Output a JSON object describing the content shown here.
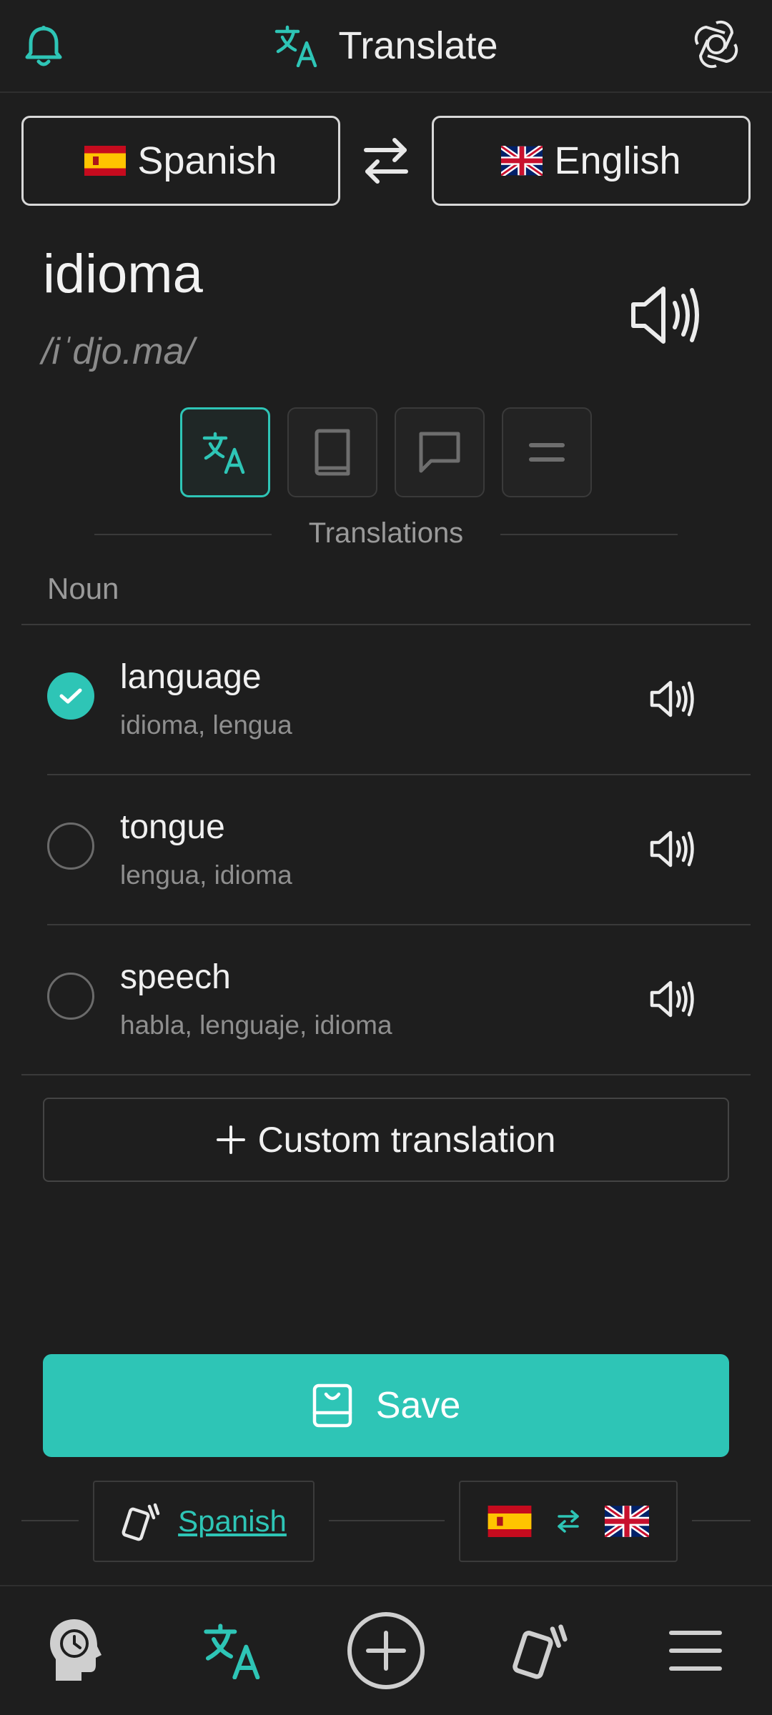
{
  "header": {
    "title": "Translate"
  },
  "languages": {
    "source": "Spanish",
    "target": "English"
  },
  "word": {
    "text": "idioma",
    "phonetic": "/iˈdjo.ma/"
  },
  "section": {
    "label": "Translations",
    "part_of_speech": "Noun"
  },
  "translations": [
    {
      "word": "language",
      "synonyms": "idioma, lengua",
      "selected": true
    },
    {
      "word": "tongue",
      "synonyms": "lengua, idioma",
      "selected": false
    },
    {
      "word": "speech",
      "synonyms": "habla, lenguaje, idioma",
      "selected": false
    }
  ],
  "actions": {
    "custom_label": "Custom translation",
    "save_label": "Save"
  },
  "footer": {
    "deck_link": "Spanish"
  },
  "colors": {
    "accent": "#2ec5b6",
    "background": "#1e1e1e"
  }
}
